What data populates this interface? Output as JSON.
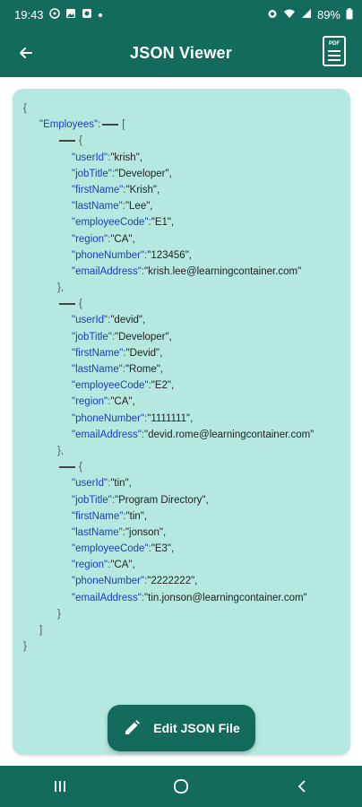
{
  "status_bar": {
    "time": "19:43",
    "battery": "89%"
  },
  "app_bar": {
    "title": "JSON Viewer",
    "pdf_icon_text": "PDF"
  },
  "json": {
    "root_key": "\"Employees\"",
    "employees": [
      {
        "fields": [
          {
            "key": "\"userId\"",
            "value": "\"krish\","
          },
          {
            "key": "\"jobTitle\"",
            "value": "\"Developer\","
          },
          {
            "key": "\"firstName\"",
            "value": "\"Krish\","
          },
          {
            "key": "\"lastName\"",
            "value": "\"Lee\","
          },
          {
            "key": "\"employeeCode\"",
            "value": "\"E1\","
          },
          {
            "key": "\"region\"",
            "value": "\"CA\","
          },
          {
            "key": "\"phoneNumber\"",
            "value": "\"123456\","
          },
          {
            "key": "\"emailAddress\"",
            "value": "\"krish.lee@learningcontainer.com\""
          }
        ]
      },
      {
        "fields": [
          {
            "key": "\"userId\"",
            "value": "\"devid\","
          },
          {
            "key": "\"jobTitle\"",
            "value": "\"Developer\","
          },
          {
            "key": "\"firstName\"",
            "value": "\"Devid\","
          },
          {
            "key": "\"lastName\"",
            "value": "\"Rome\","
          },
          {
            "key": "\"employeeCode\"",
            "value": "\"E2\","
          },
          {
            "key": "\"region\"",
            "value": "\"CA\","
          },
          {
            "key": "\"phoneNumber\"",
            "value": "\"1111111\","
          },
          {
            "key": "\"emailAddress\"",
            "value": "\"devid.rome@learningcontainer.com\""
          }
        ]
      },
      {
        "fields": [
          {
            "key": "\"userId\"",
            "value": "\"tin\","
          },
          {
            "key": "\"jobTitle\"",
            "value": "\"Program Directory\","
          },
          {
            "key": "\"firstName\"",
            "value": "\"tin\","
          },
          {
            "key": "\"lastName\"",
            "value": "\"jonson\","
          },
          {
            "key": "\"employeeCode\"",
            "value": "\"E3\","
          },
          {
            "key": "\"region\"",
            "value": "\"CA\","
          },
          {
            "key": "\"phoneNumber\"",
            "value": "\"2222222\","
          },
          {
            "key": "\"emailAddress\"",
            "value": "\"tin.jonson@learningcontainer.com\""
          }
        ]
      }
    ]
  },
  "fab": {
    "label": "Edit JSON File"
  },
  "colors": {
    "primary": "#136b5d",
    "card_bg": "#b5e9df",
    "key_color": "#1a3cc4"
  }
}
